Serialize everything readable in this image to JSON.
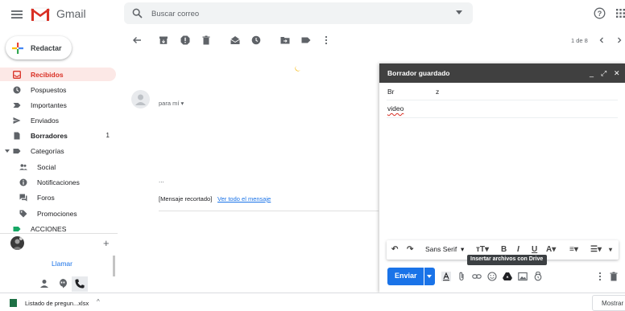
{
  "app": {
    "brand": "Gmail",
    "brand_color": "#d93025"
  },
  "search": {
    "placeholder": "Buscar correo"
  },
  "compose_label": "Redactar",
  "nav": [
    {
      "label": "Recibidos",
      "count": "",
      "icon": "inbox-icon",
      "active": true
    },
    {
      "label": "Pospuestos",
      "count": "",
      "icon": "clock-icon"
    },
    {
      "label": "Importantes",
      "count": "",
      "icon": "important-icon"
    },
    {
      "label": "Enviados",
      "count": "",
      "icon": "send-icon"
    },
    {
      "label": "Borradores",
      "count": "1",
      "icon": "draft-icon"
    },
    {
      "label": "Categorías",
      "count": "",
      "icon": "label-icon"
    },
    {
      "label": "Social",
      "count": "",
      "icon": "people-icon"
    },
    {
      "label": "Notificaciones",
      "count": "",
      "icon": "info-icon"
    },
    {
      "label": "Foros",
      "count": "",
      "icon": "forum-icon"
    },
    {
      "label": "Promociones",
      "count": "",
      "icon": "tag-icon"
    },
    {
      "label": "ACCIONES",
      "count": "",
      "icon": "label-green-icon"
    }
  ],
  "hangouts": {
    "call_label": "Llamar"
  },
  "toolbar": {
    "pager": "1 de 8"
  },
  "message": {
    "to_me": "para mí",
    "ellipsis": "...",
    "clipped": "[Mensaje recortado]",
    "view_full": "Ver todo el mensaje"
  },
  "compose": {
    "title": "Borrador guardado",
    "to_part1": "Br",
    "to_part2": "z",
    "subject": "video",
    "font": "Sans Serif",
    "tooltip": "Insertar archivos con Drive",
    "send": "Enviar"
  },
  "downloads": {
    "file": "Listado de pregun...xlsx",
    "show_all": "Mostrar t"
  }
}
